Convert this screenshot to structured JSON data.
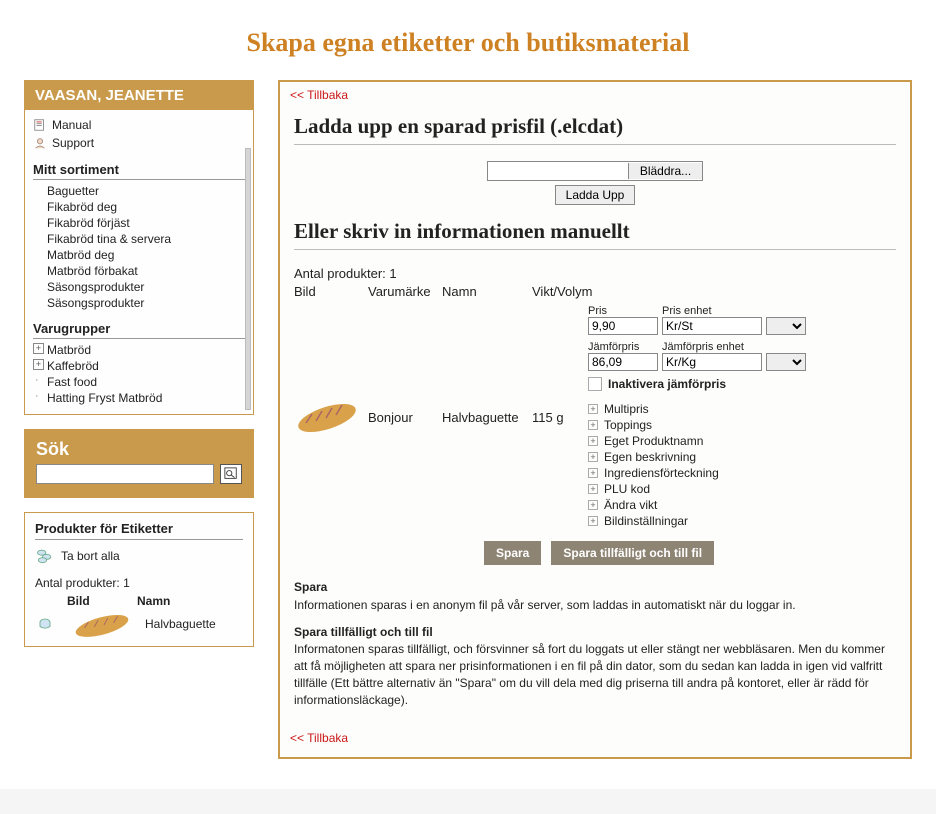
{
  "page_title": "Skapa egna etiketter och butiksmaterial",
  "user_header": "VAASAN, JEANETTE",
  "top_links": {
    "manual": "Manual",
    "support": "Support"
  },
  "sortiment": {
    "title": "Mitt sortiment",
    "items": [
      "Baguetter",
      "Fikabröd deg",
      "Fikabröd förjäst",
      "Fikabröd tina & servera",
      "Matbröd deg",
      "Matbröd förbakat",
      "Säsongsprodukter",
      "Säsongsprodukter"
    ]
  },
  "varugrupper": {
    "title": "Varugrupper",
    "items": [
      {
        "label": "Matbröd",
        "style": "plus"
      },
      {
        "label": "Kaffebröd",
        "style": "plus"
      },
      {
        "label": "Fast food",
        "style": "dash"
      },
      {
        "label": "Hatting Fryst Matbröd",
        "style": "dash"
      }
    ]
  },
  "search": {
    "title": "Sök",
    "placeholder": ""
  },
  "etiketter": {
    "title": "Produkter för Etiketter",
    "remove_all": "Ta bort alla",
    "count_prefix": "Antal produkter:",
    "count": "1",
    "head": {
      "bild": "Bild",
      "namn": "Namn"
    },
    "row": {
      "name": "Halvbaguette"
    }
  },
  "main": {
    "back": "<< Tillbaka",
    "upload_title": "Ladda upp en sparad prisfil (.elcdat)",
    "browse": "Bläddra...",
    "upload_btn": "Ladda Upp",
    "manual_title": "Eller skriv in informationen manuellt",
    "count_prefix": "Antal produkter:",
    "count": "1",
    "head": {
      "bild": "Bild",
      "brand": "Varumärke",
      "name": "Namn",
      "weight": "Vikt/Volym"
    },
    "product": {
      "brand": "Bonjour",
      "name": "Halvbaguette",
      "weight": "115 g"
    },
    "fields": {
      "pris_label": "Pris",
      "pris": "9,90",
      "enhet_label": "Pris enhet",
      "enhet": "Kr/St",
      "jmf_label": "Jämförpris",
      "jmf": "86,09",
      "jmf_enhet_label": "Jämförpris enhet",
      "jmf_enhet": "Kr/Kg",
      "inactivate": "Inaktivera jämförpris"
    },
    "expands": [
      "Multipris",
      "Toppings",
      "Eget Produktnamn",
      "Egen beskrivning",
      "Ingrediensförteckning",
      "PLU kod",
      "Ändra vikt",
      "Bildinställningar"
    ],
    "btn_save": "Spara",
    "btn_save_file": "Spara tillfälligt och till fil",
    "desc1_head": "Spara",
    "desc1_body": "Informationen sparas i en anonym fil på vår server, som laddas in automatiskt när du loggar in.",
    "desc2_head": "Spara tillfälligt och till fil",
    "desc2_body": "Informatonen sparas tillfälligt, och försvinner så fort du loggats ut eller stängt ner webbläsaren. Men du kommer att få möjligheten att spara ner prisinformationen i en fil på din dator, som du sedan kan ladda in igen vid valfritt tillfälle (Ett bättre alternativ än \"Spara\" om du vill dela med dig priserna till andra på kontoret, eller är rädd för informationsläckage)."
  }
}
